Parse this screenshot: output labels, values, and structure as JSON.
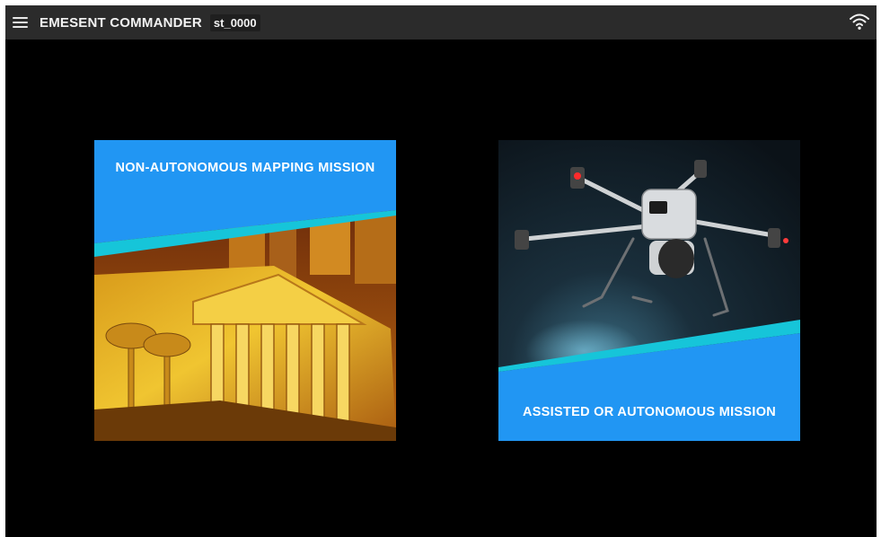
{
  "header": {
    "title": "EMESENT COMMANDER",
    "station_id": "st_0000",
    "menu_icon": "hamburger-menu-icon",
    "status_icon": "wifi-icon"
  },
  "missions": [
    {
      "label": "NON-AUTONOMOUS MAPPING MISSION",
      "image": "point-cloud-building"
    },
    {
      "label": "ASSISTED OR AUTONOMOUS MISSION",
      "image": "drone-in-tunnel"
    }
  ],
  "colors": {
    "accent_blue": "#2196F3",
    "accent_teal": "#16C5D9",
    "topbar": "#2B2B2B",
    "background": "#000000"
  }
}
